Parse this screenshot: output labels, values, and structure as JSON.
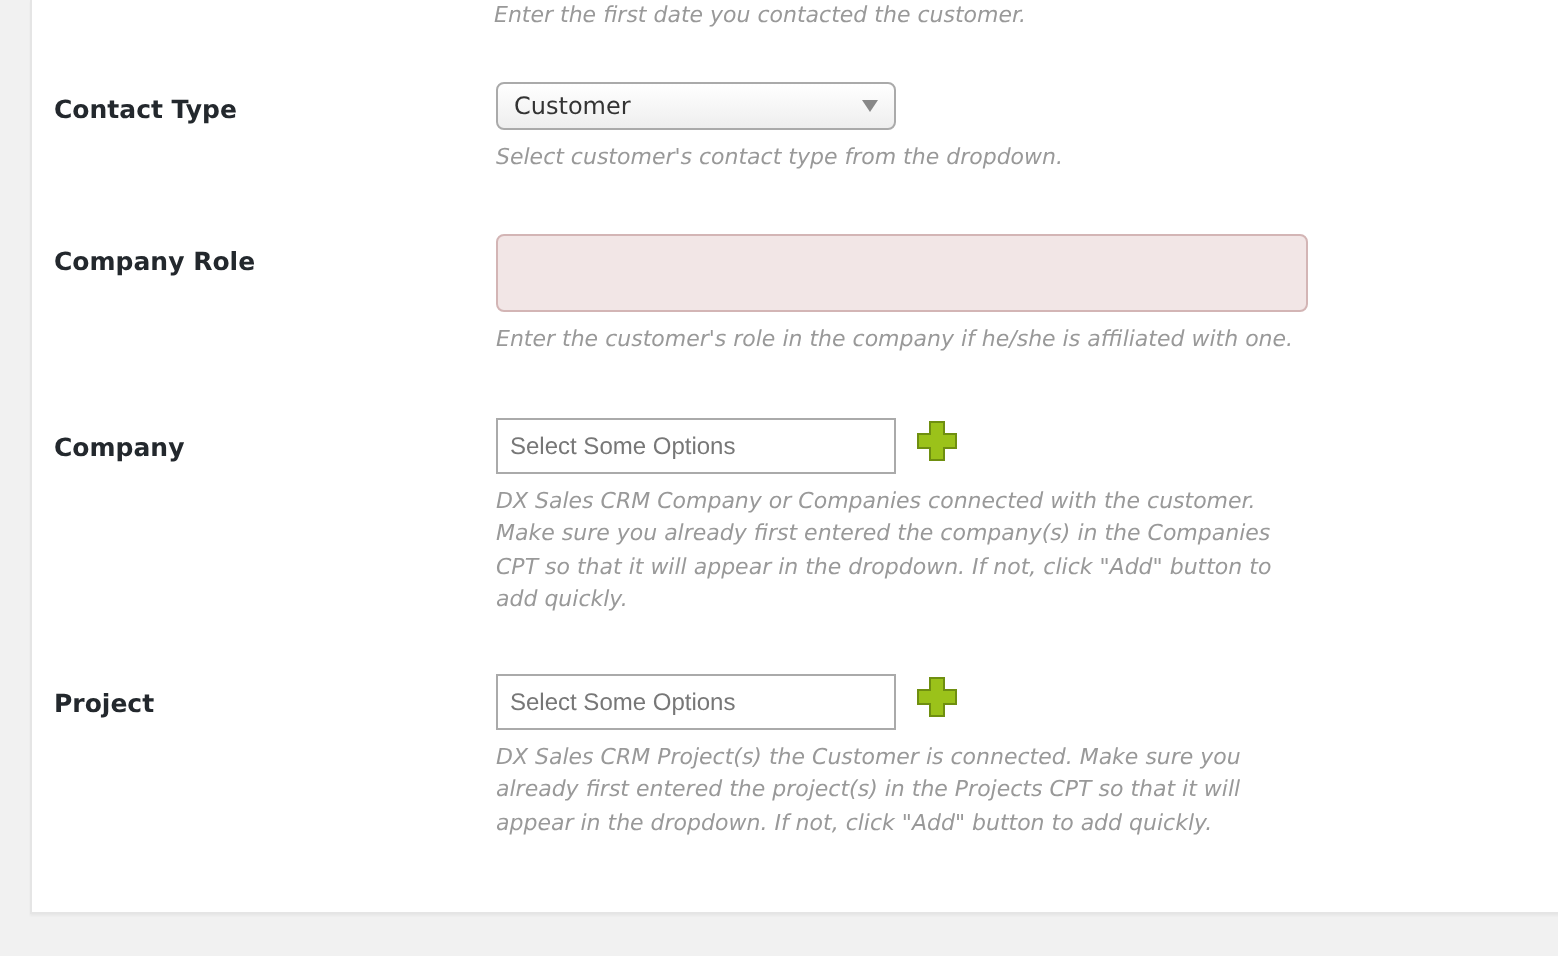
{
  "top_hint": "Enter the first date you contacted the customer.",
  "fields": [
    {
      "kind": "select",
      "label": "Contact Type",
      "value": "Customer",
      "invalid": false,
      "hint": "Select customer's contact type from the dropdown."
    },
    {
      "kind": "textarea",
      "label": "Company Role",
      "invalid": true,
      "hint": "Enter the customer's role in the company if he/she is affiliated with one."
    },
    {
      "kind": "multiselect",
      "label": "Company",
      "placeholder": "Select Some Options",
      "invalid": false,
      "hint": "DX Sales CRM Company or Companies connected with the customer. Make sure you already first entered the company(s) in the Companies CPT so that it will appear in the dropdown. If not, click \"Add\" button to add quickly."
    },
    {
      "kind": "multiselect",
      "label": "Project",
      "placeholder": "Select Some Options",
      "invalid": false,
      "hint": "DX Sales CRM Project(s) the Customer is connected. Make sure you already first entered the project(s) in the Projects CPT so that it will appear in the dropdown. If not, click \"Add\" button to add quickly."
    }
  ]
}
